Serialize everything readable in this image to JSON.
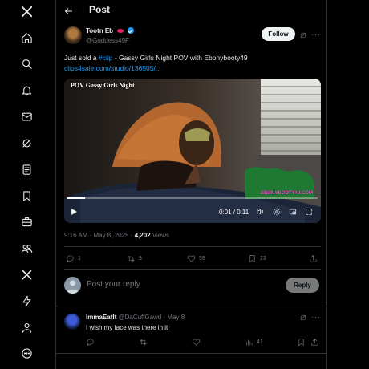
{
  "header": {
    "title": "Post"
  },
  "post": {
    "author_name": "Tootn Eb",
    "author_handle": "@Goddess49F",
    "follow_label": "Follow",
    "text_prefix": "Just sold a ",
    "hashtag": "#clip",
    "text_suffix": " - Gassy Girls Night POV with Ebonybooty49",
    "link": "clips4sale.com/studio/136505/...",
    "video": {
      "overlay_title": "POV Gassy Girls Night",
      "watermark": "EBONYBOOTY49.COM",
      "time": "0:01 / 0:11",
      "progress": 0.07
    },
    "timestamp": "9:16 AM · May 8, 2025 · ",
    "views_count": "4,202",
    "views_label": " Views",
    "stats": {
      "replies": "1",
      "reposts": "3",
      "likes": "59",
      "bookmarks": "23"
    }
  },
  "reply_box": {
    "placeholder": "Post your reply",
    "button_label": "Reply"
  },
  "reply": {
    "name": "ImmaEatIt",
    "handle_time": "@DaCuffGawd · May 8",
    "text": "I wish my face was there in it",
    "views": "41"
  },
  "sidebar": {
    "items": [
      "x-logo",
      "home-icon",
      "explore-icon",
      "notifications-icon",
      "messages-icon",
      "grok-icon",
      "lists-icon",
      "bookmarks-icon",
      "jobs-icon",
      "communities-icon",
      "premium-icon",
      "verified-orgs-icon",
      "profile-icon",
      "more-icon"
    ]
  },
  "colors": {
    "accent": "#1d9bf0",
    "background": "#000000",
    "muted": "#71767b",
    "text": "#e7e9ea"
  }
}
